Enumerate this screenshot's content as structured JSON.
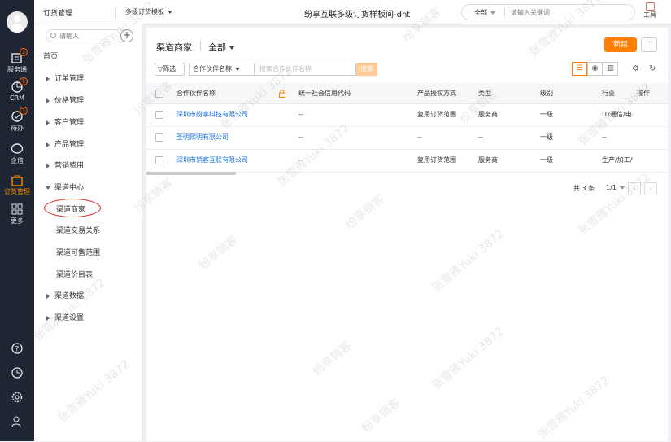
{
  "rail": {
    "items": [
      {
        "label": "服务通",
        "badge": "1"
      },
      {
        "label": "CRM",
        "badge": "1"
      },
      {
        "label": "待办",
        "badge": "1"
      },
      {
        "label": "企信",
        "badge": ""
      },
      {
        "label": "订货管理",
        "badge": ""
      },
      {
        "label": "更多",
        "badge": ""
      }
    ]
  },
  "header": {
    "app": "订货管理",
    "template": "多级订货模板",
    "title": "纷享互联多级订货样板间-dht",
    "search_scope": "全部",
    "search_placeholder": "请输入关键词",
    "tools_label": "工具"
  },
  "sidebar": {
    "search_placeholder": "请输入",
    "plus": "+",
    "items": [
      {
        "label": "首页"
      },
      {
        "label": "订单管理"
      },
      {
        "label": "价格管理"
      },
      {
        "label": "客户管理"
      },
      {
        "label": "产品管理"
      },
      {
        "label": "营销费用"
      },
      {
        "label": "渠道中心"
      },
      {
        "label": "渠道商家"
      },
      {
        "label": "渠道交易关系"
      },
      {
        "label": "渠道可售范围"
      },
      {
        "label": "渠道价目表"
      },
      {
        "label": "渠道数据"
      },
      {
        "label": "渠道设置"
      }
    ]
  },
  "main": {
    "title": "渠道商家",
    "view": "全部",
    "new_label": "新建",
    "more_label": "···",
    "filter_label": "筛选",
    "field_label": "合作伙伴名称",
    "field_placeholder": "搜索合作伙伴名称",
    "search_btn": "搜索",
    "columns": [
      "合作伙伴名称",
      "统一社会信用代码",
      "产品授权方式",
      "类型",
      "级别",
      "行业",
      "操作"
    ],
    "rows": [
      [
        "深圳市纷享科技有限公司",
        "--",
        "复用订货范围",
        "服务商",
        "一级",
        "IT/通信/电子/互联网"
      ],
      [
        "圣明熙明有限公司",
        "--",
        "--",
        "--",
        "一级",
        "--"
      ],
      [
        "深圳市销客互联有限公司",
        "--",
        "复用订货范围",
        "服务商",
        "一级",
        "生产/加工/制造"
      ]
    ],
    "total": "共 3 条",
    "page": "1/1"
  },
  "watermark": "张雪雅Yuki 3872",
  "watermark2": "纷享销客"
}
